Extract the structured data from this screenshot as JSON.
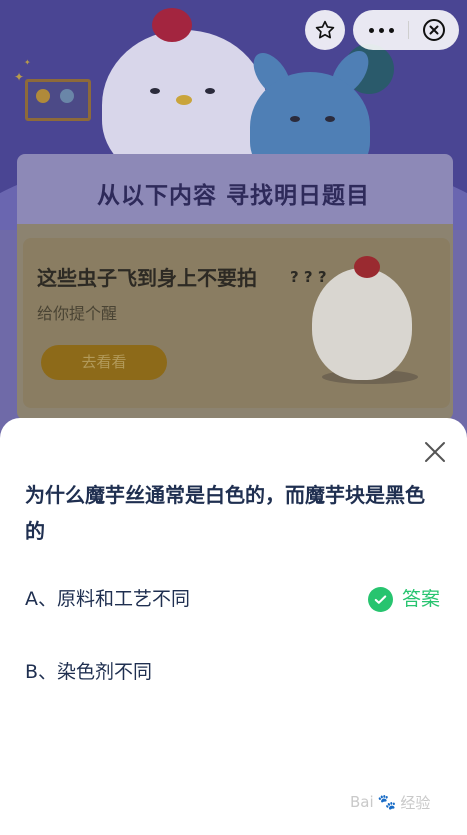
{
  "banner": {
    "title": "从以下内容 寻找明日题目"
  },
  "card": {
    "title": "这些虫子飞到身上不要拍",
    "subtitle": "给你提个醒",
    "button_label": "去看看",
    "question_marks": "?⁠?⁠?"
  },
  "controls": {
    "favorite_icon": "star-icon",
    "more_icon": "more-icon",
    "close_icon": "close-circle-icon"
  },
  "quiz": {
    "question": "为什么魔芋丝通常是白色的，而魔芋块是黑色的",
    "options": [
      {
        "label": "A、原料和工艺不同",
        "is_answer": true
      },
      {
        "label": "B、染色剂不同",
        "is_answer": false
      }
    ],
    "answer_label": "答案",
    "answer_color": "#27c46f"
  },
  "watermark": {
    "left": "Bai",
    "right": "经验"
  }
}
